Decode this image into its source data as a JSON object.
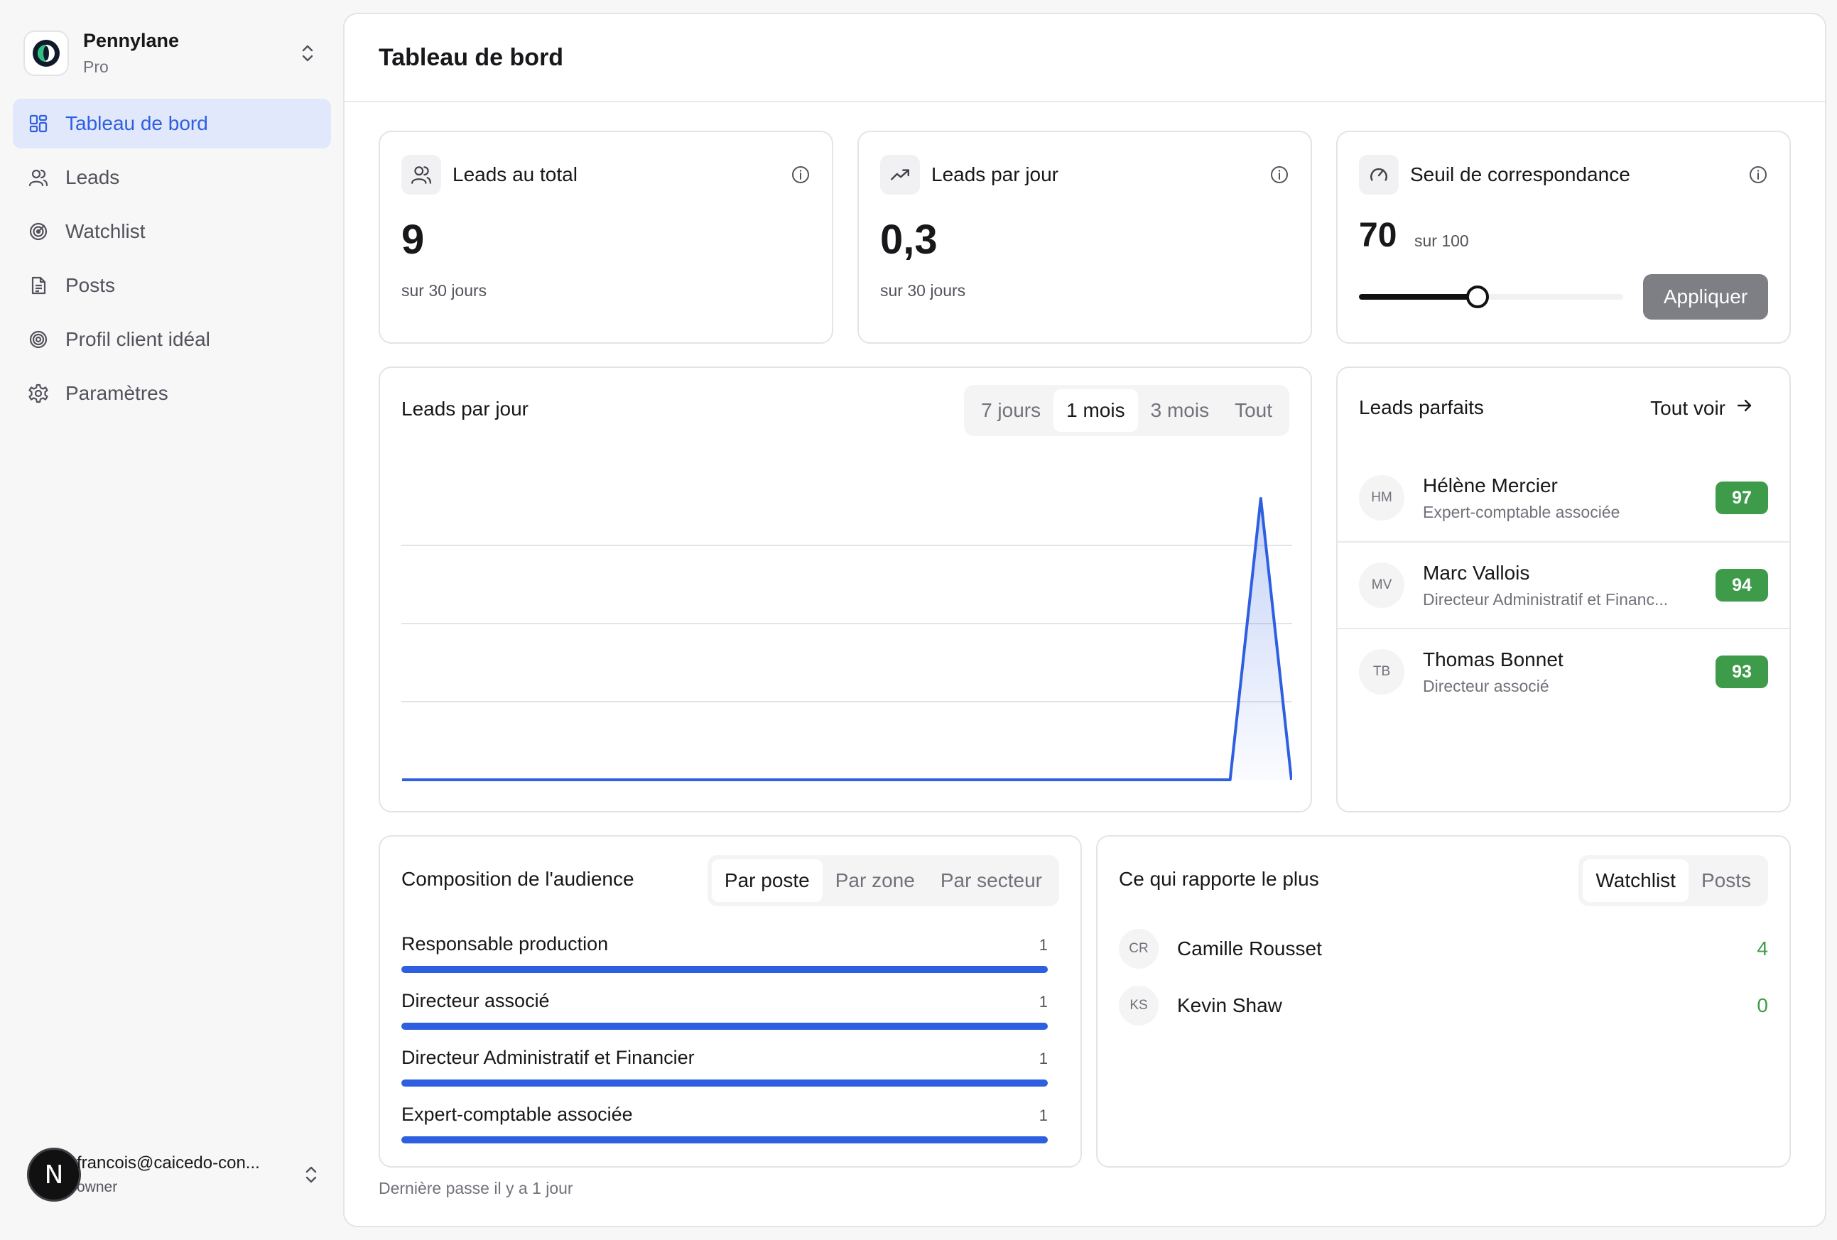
{
  "org": {
    "name": "Pennylane",
    "plan": "Pro"
  },
  "nav": [
    {
      "label": "Tableau de bord",
      "icon": "dashboard-icon",
      "active": true
    },
    {
      "label": "Leads",
      "icon": "users-icon",
      "active": false
    },
    {
      "label": "Watchlist",
      "icon": "radar-icon",
      "active": false
    },
    {
      "label": "Posts",
      "icon": "document-icon",
      "active": false
    },
    {
      "label": "Profil client idéal",
      "icon": "target-icon",
      "active": false
    },
    {
      "label": "Paramètres",
      "icon": "gear-icon",
      "active": false
    }
  ],
  "user": {
    "initial": "N",
    "email": "francois@caicedo-con...",
    "role": "owner"
  },
  "page": {
    "title": "Tableau de bord",
    "footer": "Dernière passe il y a 1 jour"
  },
  "stats": {
    "total": {
      "label": "Leads au total",
      "value": "9",
      "sub": "sur 30 jours"
    },
    "per_day": {
      "label": "Leads par jour",
      "value": "0,3",
      "sub": "sur 30 jours"
    },
    "threshold": {
      "label": "Seuil de correspondance",
      "value": "70",
      "of": "sur 100",
      "level": 70,
      "max": 100,
      "apply_label": "Appliquer"
    }
  },
  "chart_card": {
    "title": "Leads par jour",
    "ranges": [
      "7 jours",
      "1 mois",
      "3 mois",
      "Tout"
    ],
    "active_range": 1
  },
  "chart_data": {
    "type": "area",
    "title": "Leads par jour",
    "xlabel": "",
    "ylabel": "",
    "grid": true,
    "values": [
      0,
      0,
      0,
      0,
      0,
      0,
      0,
      0,
      0,
      0,
      0,
      0,
      0,
      0,
      0,
      0,
      0,
      0,
      0,
      0,
      0,
      0,
      0,
      0,
      0,
      0,
      0,
      0,
      9,
      0
    ],
    "ylim": [
      0,
      10
    ]
  },
  "perfect_leads": {
    "title": "Leads parfaits",
    "see_all": "Tout voir",
    "items": [
      {
        "initials": "HM",
        "name": "Hélène Mercier",
        "title": "Expert-comptable associée",
        "score": "97"
      },
      {
        "initials": "MV",
        "name": "Marc Vallois",
        "title": "Directeur Administratif et Financ...",
        "score": "94"
      },
      {
        "initials": "TB",
        "name": "Thomas Bonnet",
        "title": "Directeur associé",
        "score": "93"
      }
    ]
  },
  "audience": {
    "title": "Composition de l'audience",
    "tabs": [
      "Par poste",
      "Par zone",
      "Par secteur"
    ],
    "active_tab": 0,
    "rows": [
      {
        "label": "Responsable production",
        "count": "1",
        "fraction": 1
      },
      {
        "label": "Directeur associé",
        "count": "1",
        "fraction": 1
      },
      {
        "label": "Directeur Administratif et Financier",
        "count": "1",
        "fraction": 1
      },
      {
        "label": "Expert-comptable associée",
        "count": "1",
        "fraction": 1
      }
    ]
  },
  "earners": {
    "title": "Ce qui rapporte le plus",
    "tabs": [
      "Watchlist",
      "Posts"
    ],
    "active_tab": 0,
    "rows": [
      {
        "initials": "CR",
        "name": "Camille Rousset",
        "value": "4"
      },
      {
        "initials": "KS",
        "name": "Kevin Shaw",
        "value": "0"
      }
    ]
  },
  "colors": {
    "accent": "#2d5fe0",
    "success": "#3e9b4a",
    "active_nav_bg": "#e2e8fb"
  }
}
